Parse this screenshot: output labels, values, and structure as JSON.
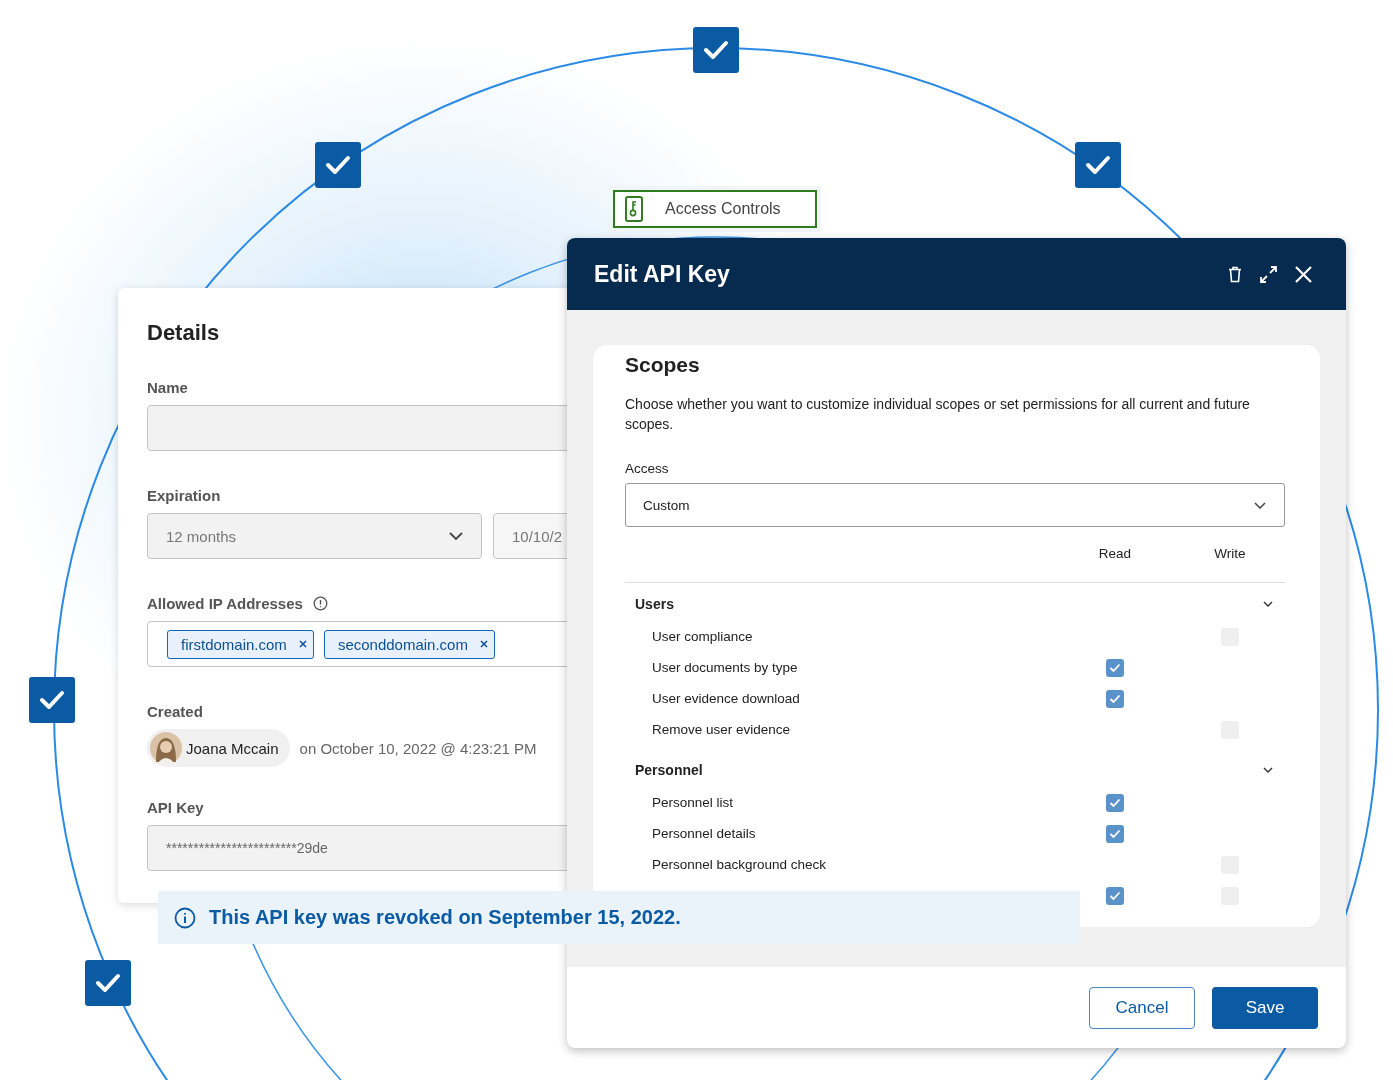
{
  "tag": {
    "label": "Access Controls"
  },
  "details": {
    "title": "Details",
    "name": {
      "label": "Name"
    },
    "expiration": {
      "label": "Expiration",
      "period": "12 months",
      "date": "10/10/2"
    },
    "allowed_ips": {
      "label": "Allowed IP Addresses",
      "tags": [
        "firstdomain.com",
        "seconddomain.com"
      ]
    },
    "created": {
      "label": "Created",
      "user": "Joana Mccain",
      "timestamp": "on October 10, 2022 @ 4:23:21 PM"
    },
    "api_key": {
      "label": "API Key",
      "value": "************************29de"
    }
  },
  "modal": {
    "title": "Edit API Key",
    "scopes": {
      "title": "Scopes",
      "description": "Choose whether you want to customize individual scopes or set permissions for all current and future scopes.",
      "access_label": "Access",
      "access_value": "Custom",
      "columns": [
        "Read",
        "Write"
      ],
      "groups": [
        {
          "name": "Users",
          "expanded": true,
          "items": [
            {
              "label": "User compliance",
              "write": false
            },
            {
              "label": "User documents by type",
              "read": true
            },
            {
              "label": "User evidence download",
              "read": true
            },
            {
              "label": "Remove user evidence",
              "write": false
            }
          ]
        },
        {
          "name": "Personnel",
          "expanded": true,
          "items": [
            {
              "label": "Personnel list",
              "read": true
            },
            {
              "label": "Personnel details",
              "read": true
            },
            {
              "label": "Personnel background check",
              "write": false
            },
            {
              "read": true,
              "write": false
            }
          ]
        }
      ]
    },
    "buttons": [
      {
        "label": "Cancel",
        "kind": "secondary"
      },
      {
        "label": "Save",
        "kind": "primary"
      }
    ]
  },
  "banner": {
    "text": "This API key was revoked on September 15, 2022."
  }
}
